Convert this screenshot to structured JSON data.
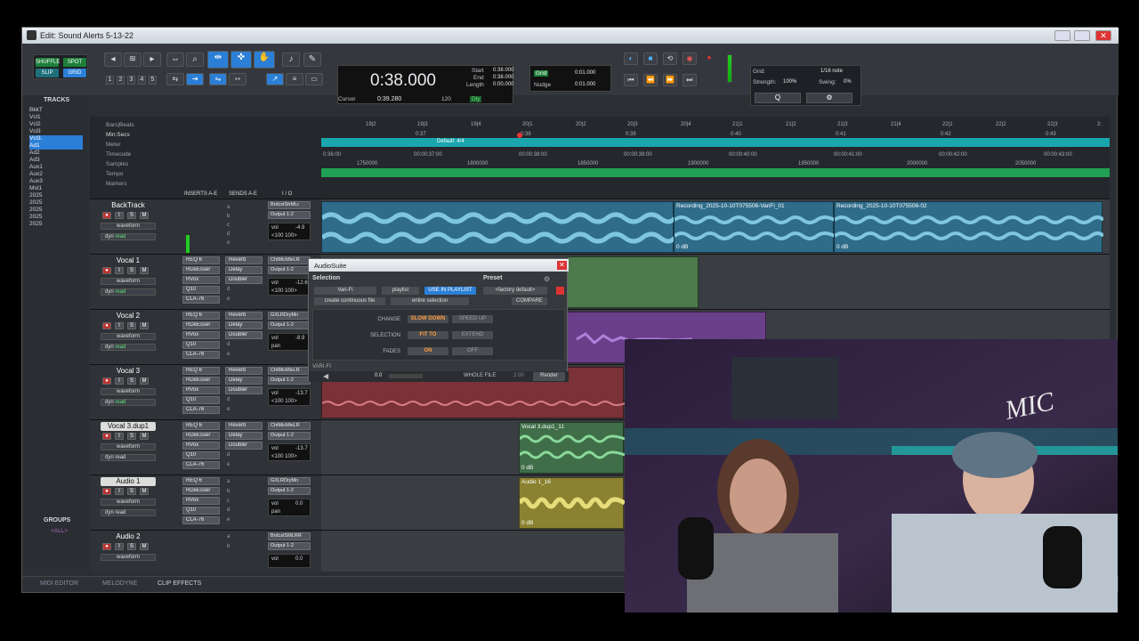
{
  "window": {
    "title": "Edit: Sound Alerts 5-13-22"
  },
  "toolbar": {
    "modes": [
      "SHUFFLE",
      "SPOT",
      "SLIP",
      "GRID"
    ],
    "numbers": [
      "1",
      "2",
      "3",
      "4",
      "5"
    ],
    "counter": {
      "main": "0:38.000",
      "start_label": "Start",
      "end_label": "End",
      "length_label": "Length",
      "start": "0:38.000",
      "end": "0:38.000",
      "length": "0:00.000",
      "cursor_label": "Cursor",
      "cursor": "0:39.280",
      "bpm": "120",
      "dly": "Dly"
    },
    "grid": {
      "label": "Grid",
      "value": "0:01.000",
      "nudge_label": "Nudge",
      "nudge_value": "0:01.000"
    },
    "midi": {
      "grid_label": "Grid:",
      "note": "1/16 note",
      "strength_label": "Strength:",
      "strength": "100%",
      "swing_label": "Swing:",
      "swing": "0%"
    }
  },
  "tracks_panel": {
    "header": "TRACKS",
    "items": [
      "BkkT",
      "Vcl1",
      "Vcl2",
      "Vcl3",
      "Vcl3.",
      "Ad1",
      "Ad2",
      "Ad3",
      "Aux1",
      "Aux2",
      "Aux3",
      "Mst1",
      "2025",
      "2025",
      "2025",
      "2025",
      "2025"
    ],
    "groups_header": "GROUPS",
    "groups_all": "<ALL>"
  },
  "rulers": {
    "labels": [
      "Bars|Beats",
      "Min:Secs",
      "Meter",
      "Timecode",
      "Samples",
      "Tempo",
      "Markers"
    ],
    "bars": [
      "19|2",
      "19|3",
      "19|4",
      "20|1",
      "20|2",
      "20|3",
      "20|4",
      "21|1",
      "21|2",
      "21|3",
      "21|4",
      "22|1",
      "22|2",
      "22|3",
      "2:"
    ],
    "minsecs": [
      "0:37",
      "0:38",
      "0:39",
      "0:40",
      "0:41",
      "0:42",
      "0:43"
    ],
    "meter": "Default: 4/4",
    "timecode": [
      "0:36:00",
      "00:00:37:00",
      "00:00:38:00",
      "00:00:39:00",
      "00:00:40:00",
      "00:00:41:00",
      "00:00:42:00",
      "00:00:43:00"
    ],
    "samples": [
      "1750000",
      "1800000",
      "1850000",
      "1900000",
      "1950000",
      "2000000",
      "2050000"
    ]
  },
  "column_headers": {
    "inserts": "INSERTS A-E",
    "sends": "SENDS A-E",
    "io": "I / O"
  },
  "tracks": [
    {
      "name": "BackTrack",
      "view": "waveform",
      "mode": "read",
      "inserts": [],
      "sends": [
        "a",
        "b",
        "c",
        "d",
        "e"
      ],
      "io_in": "BrdcstStrMLr",
      "io_out": "Output 1-2",
      "vol": "-4.9",
      "pan": "<100  100>",
      "clips": [
        {
          "name": "",
          "db": "0 dB"
        },
        {
          "name": "Recording_2025-10-10T075506-VariFi_01",
          "db": "0 dB"
        },
        {
          "name": "Recording_2025-10-10T075506-02",
          "db": "0 dB"
        }
      ]
    },
    {
      "name": "Vocal 1",
      "view": "waveform",
      "mode": "read",
      "inserts": [
        "REQ 6",
        "RDeEsser",
        "RVox",
        "Q10",
        "CLA-76"
      ],
      "sends": [
        "Reverb",
        "Delay",
        "Doubler",
        "d",
        "e"
      ],
      "io_in": "ChtMicMixLR",
      "io_out": "Output 1-2",
      "vol": "-12.6",
      "pan": "<100  100>",
      "clips": []
    },
    {
      "name": "Vocal 2",
      "view": "waveform",
      "mode": "read",
      "inserts": [
        "REQ 6",
        "RDeEsser",
        "RVox",
        "Q10",
        "CLA-76"
      ],
      "sends": [
        "Reverb",
        "Delay",
        "Doubler",
        "d",
        "e"
      ],
      "io_in": "GXLRDryMn",
      "io_out": "Output 1-2",
      "vol": "-8.9",
      "pan": "pan",
      "clips": []
    },
    {
      "name": "Vocal 3",
      "view": "waveform",
      "mode": "read",
      "inserts": [
        "REQ 6",
        "RDeEsser",
        "RVox",
        "Q10",
        "CLA-76"
      ],
      "sends": [
        "Reverb",
        "Delay",
        "Doubler",
        "d",
        "e"
      ],
      "io_in": "ChtMicMixLR",
      "io_out": "Output 1-2",
      "vol": "-13.7",
      "pan": "<100  100>",
      "clips": []
    },
    {
      "name": "Vocal 3.dup1",
      "view": "waveform",
      "mode": "read",
      "inserts": [
        "REQ 6",
        "RDeEsser",
        "RVox",
        "Q10",
        "CLA-76"
      ],
      "sends": [
        "Reverb",
        "Delay",
        "Doubler",
        "d",
        "e"
      ],
      "io_in": "ChtMicMixLR",
      "io_out": "Output 1-2",
      "vol": "-13.7",
      "pan": "<100  100>",
      "clips": [
        {
          "name": "Vocal 3.dup1_11",
          "db": "0 dB"
        }
      ]
    },
    {
      "name": "Audio 1",
      "view": "waveform",
      "mode": "read",
      "inserts": [
        "REQ 6",
        "RDeEsser",
        "RVox",
        "Q10",
        "CLA-76"
      ],
      "sends": [
        "a",
        "b",
        "c",
        "d",
        "e"
      ],
      "io_in": "GXLRDryMn",
      "io_out": "Output 1-2",
      "vol": "0.0",
      "pan": "pan",
      "clips": [
        {
          "name": "Audio 1_16",
          "db": "0 dB"
        }
      ]
    },
    {
      "name": "Audio 2",
      "view": "waveform",
      "mode": "read",
      "inserts": [],
      "sends": [
        "a",
        "b"
      ],
      "io_in": "BrdcstSMLRR",
      "io_out": "Output 1-2",
      "vol": "0.0",
      "pan": "",
      "clips": []
    }
  ],
  "audiosuite": {
    "title": "AudioSuite",
    "selection_label": "Selection",
    "preset_label": "Preset",
    "plugin": "Vari-Fi",
    "playlist": "playlist",
    "use_in_playlist": "USE IN PLAYLIST",
    "factory_default": "<factory default>",
    "create_file": "create continuous file",
    "entire_selection": "entire selection",
    "compare": "COMPARE",
    "change_label": "CHANGE",
    "slow_down": "SLOW DOWN",
    "speed_up": "SPEED UP",
    "selection_row_label": "SELECTION",
    "fit_to": "FIT TO",
    "extend": "EXTEND",
    "fades_label": "FADES",
    "on": "ON",
    "off": "OFF",
    "brand": "VARI-FI",
    "value": "0.0",
    "whole_file": "WHOLE FILE",
    "handle": "2.00",
    "render": "Render"
  },
  "bottom_tabs": [
    "MIDI EDITOR",
    "MELODYNE",
    "CLIP EFFECTS"
  ],
  "colors": {
    "accent_blue": "#2b7fd6",
    "meter_teal": "#1aa6ad",
    "tempo_green": "#20a053",
    "clip_blue": "#3d8fb0",
    "clip_green": "#4d7a4c",
    "clip_purple": "#6a3f8a",
    "clip_red": "#7a3238",
    "clip_yellow": "#8a8230"
  }
}
